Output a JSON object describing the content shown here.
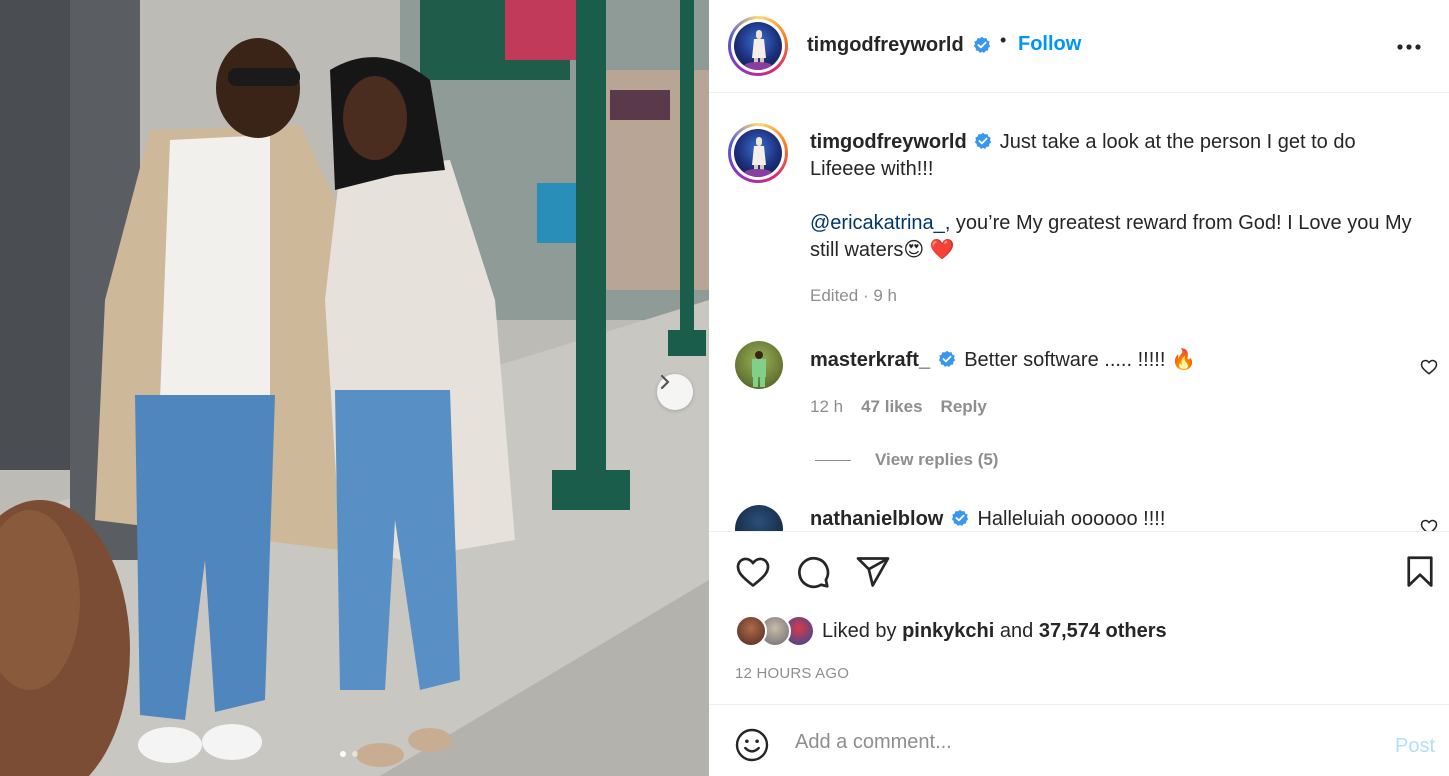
{
  "post": {
    "image_alt": "",
    "slide_count": 2,
    "active_slide": 1,
    "next_icon": "chevron-right-icon"
  },
  "header": {
    "username": "timgodfreyworld",
    "separator": "•",
    "follow_label": "Follow",
    "more_icon": "more-horizontal-icon"
  },
  "caption": {
    "username": "timgodfreyworld",
    "line1": "Just take a look at the person I get to do Lifeeee with!!!",
    "mention": "@ericakatrina_",
    "line2": ", you’re My greatest reward from God! I Love you My still waters",
    "emojis": "😍 ❤️",
    "edited_label": "Edited",
    "dot": "·",
    "time": "9 h"
  },
  "comments": [
    {
      "username": "masterkraft_",
      "text": "Better software ..... !!!!!  🔥",
      "time": "12 h",
      "likes": "47 likes",
      "reply_label": "Reply",
      "view_replies": "View replies (5)"
    },
    {
      "username": "nathanielblow",
      "text": "Halleluiah oooooo !!!!"
    }
  ],
  "actions": {
    "like_icon": "heart-icon",
    "comment_icon": "comment-icon",
    "share_icon": "paper-plane-icon",
    "save_icon": "bookmark-icon"
  },
  "likes": {
    "prefix": "Liked by",
    "liker": "pinkykchi",
    "and": "and",
    "others": "37,574 others"
  },
  "timestamp": "12 HOURS AGO",
  "add_comment": {
    "placeholder": "Add a comment...",
    "post_label": "Post"
  },
  "colors": {
    "accent": "#0095f6",
    "post_disabled": "#b2dffc",
    "secondary_text": "#8e8e8e",
    "verified": "#3897f0",
    "heart_red": "#ed4956"
  }
}
